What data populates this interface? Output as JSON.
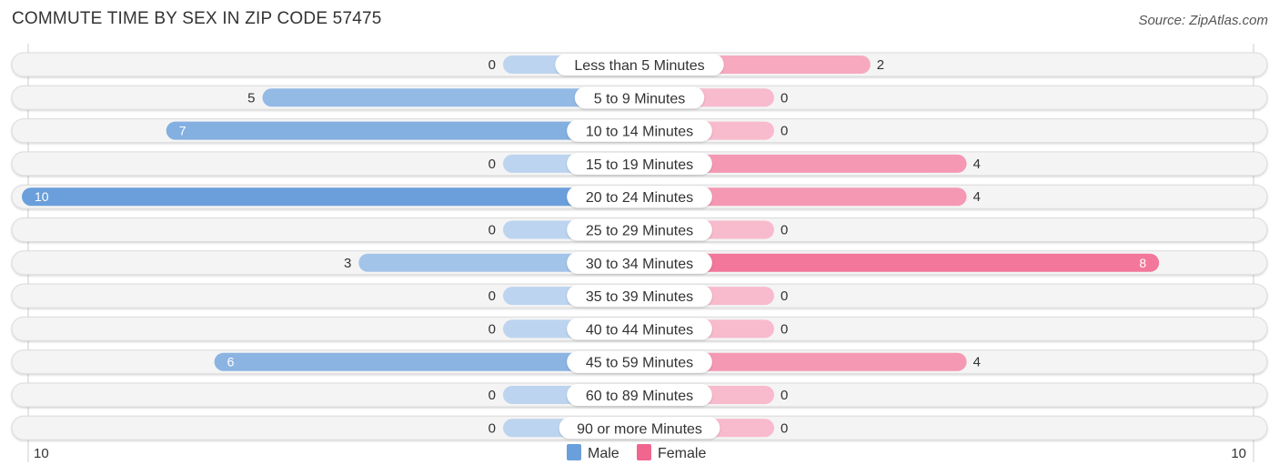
{
  "chart_data": {
    "type": "bar",
    "orientation": "horizontal-diverging",
    "title": "COMMUTE TIME BY SEX IN ZIP CODE 57475",
    "source": "Source: ZipAtlas.com",
    "categories": [
      "Less than 5 Minutes",
      "5 to 9 Minutes",
      "10 to 14 Minutes",
      "15 to 19 Minutes",
      "20 to 24 Minutes",
      "25 to 29 Minutes",
      "30 to 34 Minutes",
      "35 to 39 Minutes",
      "40 to 44 Minutes",
      "45 to 59 Minutes",
      "60 to 89 Minutes",
      "90 or more Minutes"
    ],
    "series": [
      {
        "name": "Male",
        "color": "#6a9fdb",
        "values": [
          0,
          5,
          7,
          0,
          10,
          0,
          3,
          0,
          0,
          6,
          0,
          0
        ]
      },
      {
        "name": "Female",
        "color": "#f0668f",
        "values": [
          2,
          0,
          0,
          4,
          4,
          0,
          8,
          0,
          0,
          4,
          0,
          0
        ]
      }
    ],
    "xlim": [
      10,
      10
    ],
    "axis_left_label": "10",
    "axis_right_label": "10",
    "legend": [
      "Male",
      "Female"
    ],
    "legend_position": "bottom-center"
  }
}
